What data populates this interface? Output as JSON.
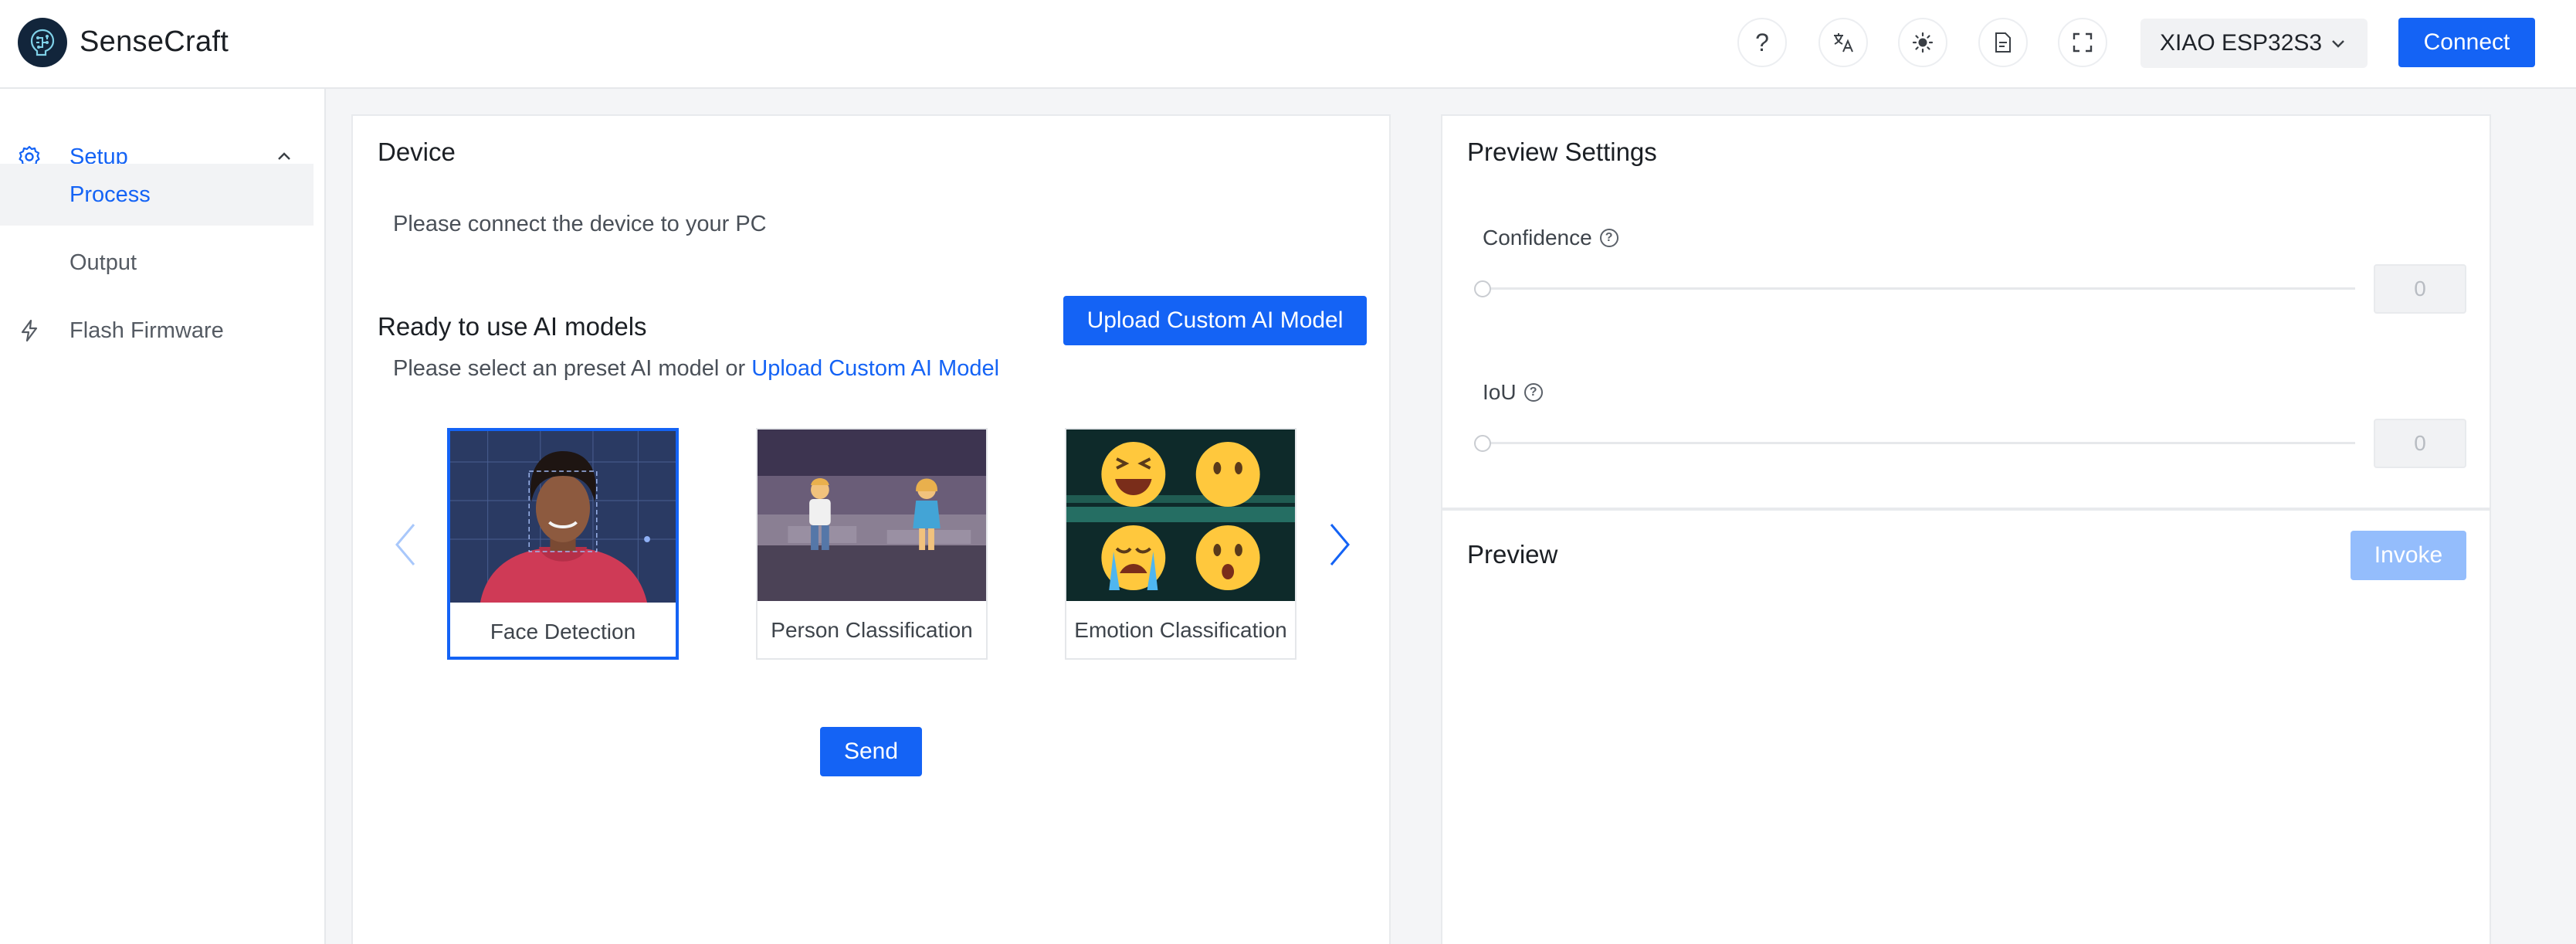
{
  "header": {
    "app_title": "SenseCraft",
    "device_select_value": "XIAO ESP32S3",
    "connect_label": "Connect",
    "icons": [
      "question-icon",
      "translate-icon",
      "theme-sun-icon",
      "document-icon",
      "fullscreen-icon"
    ]
  },
  "sidebar": {
    "items": [
      {
        "label": "Setup",
        "icon": "gear-icon"
      },
      {
        "label": "Process"
      },
      {
        "label": "Output"
      },
      {
        "label": "Flash Firmware",
        "icon": "lightning-icon"
      }
    ]
  },
  "device": {
    "title": "Device",
    "status_text": "Please connect the device to your PC",
    "models_title": "Ready to use AI models",
    "upload_button_label": "Upload Custom AI Model",
    "select_prompt_prefix": "Please select an preset AI model or ",
    "select_prompt_link": "Upload Custom AI Model",
    "models": [
      {
        "label": "Face Detection",
        "selected": true
      },
      {
        "label": "Person Classification",
        "selected": false
      },
      {
        "label": "Emotion Classification",
        "selected": false
      }
    ],
    "send_label": "Send"
  },
  "preview_settings": {
    "title": "Preview Settings",
    "confidence": {
      "label": "Confidence",
      "value": "0"
    },
    "iou": {
      "label": "IoU",
      "value": "0"
    }
  },
  "preview": {
    "title": "Preview",
    "invoke_label": "Invoke"
  },
  "colors": {
    "accent": "#1463f5",
    "accent_disabled": "#94bdfc",
    "logo_bg": "#12253b"
  }
}
